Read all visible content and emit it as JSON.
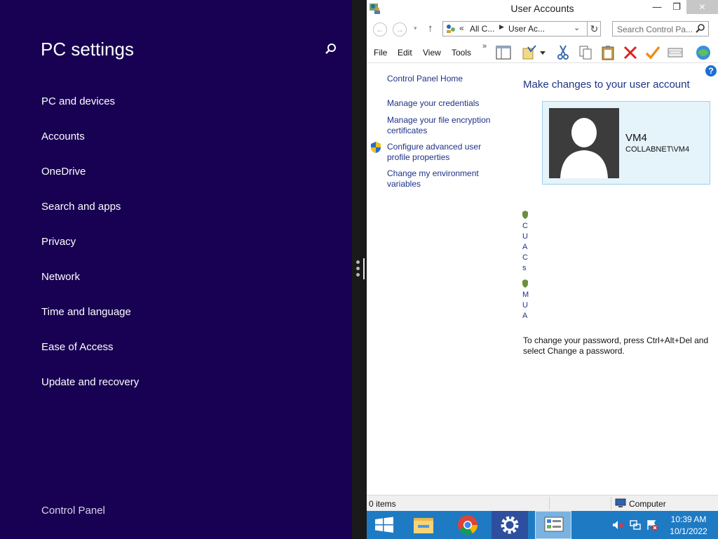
{
  "pc_settings": {
    "title": "PC settings",
    "items": [
      {
        "label": "PC and devices"
      },
      {
        "label": "Accounts"
      },
      {
        "label": "OneDrive"
      },
      {
        "label": "Search and apps"
      },
      {
        "label": "Privacy"
      },
      {
        "label": "Network"
      },
      {
        "label": "Time and language"
      },
      {
        "label": "Ease of Access"
      },
      {
        "label": "Update and recovery"
      }
    ],
    "control_panel_link": "Control Panel",
    "icons": {
      "search": "search-icon"
    },
    "colors": {
      "background": "#180052",
      "text": "#ffffff"
    }
  },
  "window": {
    "title": "User Accounts",
    "caption_buttons": {
      "minimize": "—",
      "maximize": "❐",
      "close": "✕"
    },
    "nav": {
      "back": "←",
      "forward": "→",
      "recent": "▾",
      "up": "↑",
      "address": {
        "chevron": "«",
        "crumbs": [
          "All C...",
          "User Ac..."
        ],
        "separator": "▶",
        "dropdown": "⌄",
        "refresh": "↻"
      },
      "search_placeholder": "Search Control Pa..."
    },
    "menu": [
      {
        "label": "File"
      },
      {
        "label": "Edit"
      },
      {
        "label": "View"
      },
      {
        "label": "Tools"
      }
    ],
    "menu_overflow": "»",
    "toolbar_icons": [
      "layout-icon",
      "properties-icon",
      "cut-icon",
      "copy-icon",
      "paste-icon",
      "delete-icon",
      "checkmark-icon",
      "window-icon",
      "network-icon"
    ],
    "sidebar": {
      "home": "Control Panel Home",
      "links": [
        {
          "label": "Manage your credentials"
        },
        {
          "label": "Manage your file encryption certificates"
        },
        {
          "label": "Configure advanced user profile properties",
          "icon": "shield-icon"
        },
        {
          "label": "Change my environment variables"
        }
      ]
    },
    "help": "?",
    "main": {
      "heading": "Make changes to your user account",
      "account": {
        "name": "VM4",
        "domain": "COLLABNET\\VM4"
      },
      "truncated_links": [
        [
          "C",
          "U",
          "A",
          "C",
          "s"
        ],
        [
          "M",
          "U",
          "A"
        ]
      ],
      "password_note": "To change your password, press Ctrl+Alt+Del and select Change a password."
    },
    "status": {
      "items": "0 items",
      "location": "Computer"
    },
    "colors": {
      "link": "#1e3287",
      "card_bg": "#e5f3fb",
      "card_border": "#9fd0f0"
    }
  },
  "taskbar": {
    "apps": [
      {
        "name": "start-button"
      },
      {
        "name": "file-explorer"
      },
      {
        "name": "chrome"
      },
      {
        "name": "pc-settings"
      },
      {
        "name": "control-panel"
      }
    ],
    "clock": {
      "time": "10:39 AM",
      "date": "10/1/2022"
    },
    "colors": {
      "bar": "#1f7ac4"
    }
  }
}
